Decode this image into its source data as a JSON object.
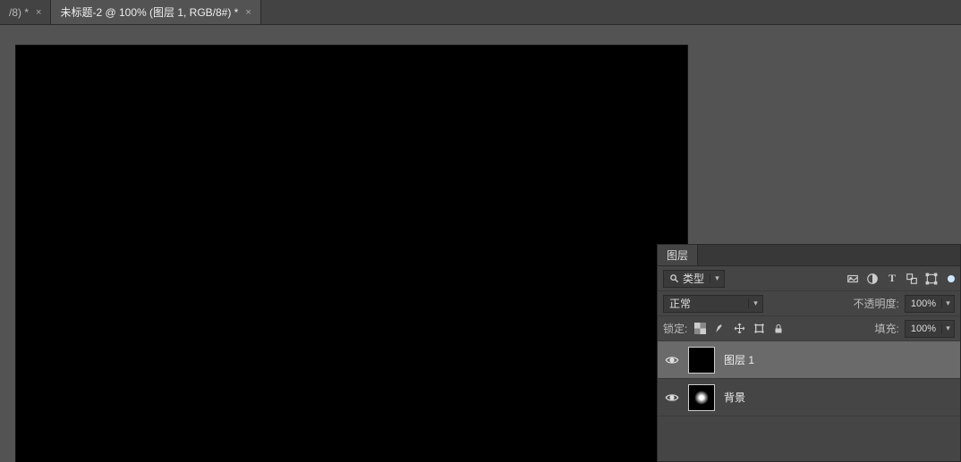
{
  "tabs": {
    "inactive_suffix": "/8) *",
    "active": "未标题-2 @ 100% (图层 1, RGB/8#) *"
  },
  "panel": {
    "title": "图层",
    "filter_label": "类型",
    "blend_mode": "正常",
    "opacity_label": "不透明度:",
    "opacity_value": "100%",
    "lock_label": "锁定:",
    "fill_label": "填充:",
    "fill_value": "100%"
  },
  "layers": [
    {
      "name": "图层 1",
      "selected": true,
      "glow": false
    },
    {
      "name": "背景",
      "selected": false,
      "glow": true
    }
  ]
}
